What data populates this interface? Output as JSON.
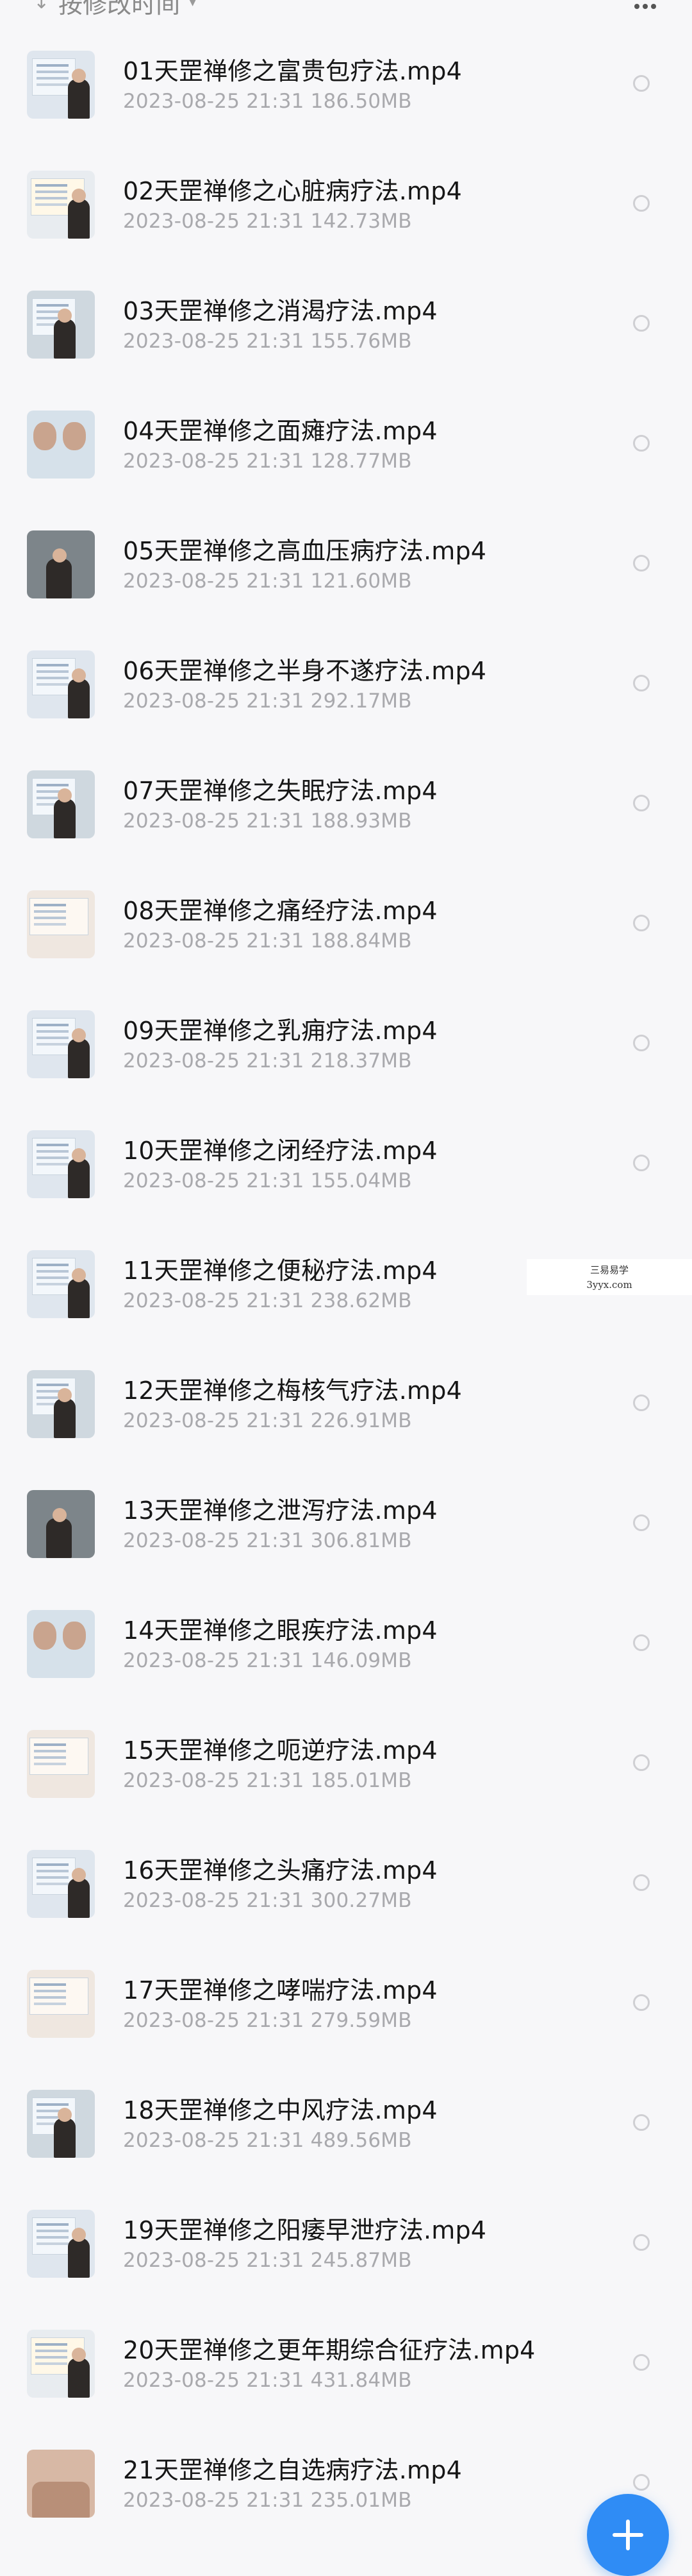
{
  "toolbar": {
    "sort_label": "按修改时间",
    "sort_icon": "arrow-down-icon",
    "more_icon": "grid-more-icon"
  },
  "files": [
    {
      "name": "01天罡禅修之富贵包疗法.mp4",
      "date": "2023-08-25",
      "time": "21:31",
      "size": "186.50MB",
      "thumb": "v1"
    },
    {
      "name": "02天罡禅修之心脏病疗法.mp4",
      "date": "2023-08-25",
      "time": "21:31",
      "size": "142.73MB",
      "thumb": "v2"
    },
    {
      "name": "03天罡禅修之消渴疗法.mp4",
      "date": "2023-08-25",
      "time": "21:31",
      "size": "155.76MB",
      "thumb": "v3"
    },
    {
      "name": "04天罡禅修之面瘫疗法.mp4",
      "date": "2023-08-25",
      "time": "21:31",
      "size": "128.77MB",
      "thumb": "v4"
    },
    {
      "name": "05天罡禅修之高血压病疗法.mp4",
      "date": "2023-08-25",
      "time": "21:31",
      "size": "121.60MB",
      "thumb": "v5"
    },
    {
      "name": "06天罡禅修之半身不遂疗法.mp4",
      "date": "2023-08-25",
      "time": "21:31",
      "size": "292.17MB",
      "thumb": "v1"
    },
    {
      "name": "07天罡禅修之失眠疗法.mp4",
      "date": "2023-08-25",
      "time": "21:31",
      "size": "188.93MB",
      "thumb": "v3"
    },
    {
      "name": "08天罡禅修之痛经疗法.mp4",
      "date": "2023-08-25",
      "time": "21:31",
      "size": "188.84MB",
      "thumb": "v6"
    },
    {
      "name": "09天罡禅修之乳痈疗法.mp4",
      "date": "2023-08-25",
      "time": "21:31",
      "size": "218.37MB",
      "thumb": "v1"
    },
    {
      "name": "10天罡禅修之闭经疗法.mp4",
      "date": "2023-08-25",
      "time": "21:31",
      "size": "155.04MB",
      "thumb": "v1"
    },
    {
      "name": "11天罡禅修之便秘疗法.mp4",
      "date": "2023-08-25",
      "time": "21:31",
      "size": "238.62MB",
      "thumb": "v1"
    },
    {
      "name": "12天罡禅修之梅核气疗法.mp4",
      "date": "2023-08-25",
      "time": "21:31",
      "size": "226.91MB",
      "thumb": "v3"
    },
    {
      "name": "13天罡禅修之泄泻疗法.mp4",
      "date": "2023-08-25",
      "time": "21:31",
      "size": "306.81MB",
      "thumb": "v5"
    },
    {
      "name": "14天罡禅修之眼疾疗法.mp4",
      "date": "2023-08-25",
      "time": "21:31",
      "size": "146.09MB",
      "thumb": "v4"
    },
    {
      "name": "15天罡禅修之呃逆疗法.mp4",
      "date": "2023-08-25",
      "time": "21:31",
      "size": "185.01MB",
      "thumb": "v6"
    },
    {
      "name": "16天罡禅修之头痛疗法.mp4",
      "date": "2023-08-25",
      "time": "21:31",
      "size": "300.27MB",
      "thumb": "v1"
    },
    {
      "name": "17天罡禅修之哮喘疗法.mp4",
      "date": "2023-08-25",
      "time": "21:31",
      "size": "279.59MB",
      "thumb": "v6"
    },
    {
      "name": "18天罡禅修之中风疗法.mp4",
      "date": "2023-08-25",
      "time": "21:31",
      "size": "489.56MB",
      "thumb": "v3"
    },
    {
      "name": "19天罡禅修之阳痿早泄疗法.mp4",
      "date": "2023-08-25",
      "time": "21:31",
      "size": "245.87MB",
      "thumb": "v1"
    },
    {
      "name": "20天罡禅修之更年期综合征疗法.mp4",
      "date": "2023-08-25",
      "time": "21:31",
      "size": "431.84MB",
      "thumb": "v2"
    },
    {
      "name": "21天罡禅修之自选病疗法.mp4",
      "date": "2023-08-25",
      "time": "21:31",
      "size": "235.01MB",
      "thumb": "v7"
    }
  ],
  "watermark": {
    "line1": "三易易学",
    "line2": "3yyx.com"
  },
  "fab": {
    "icon": "plus-icon",
    "color": "#2f8cf5"
  },
  "colors": {
    "background": "#f7f7f9",
    "title_text": "#161616",
    "meta_text": "#a9a9ad",
    "radio_border": "#cfcfd3"
  }
}
